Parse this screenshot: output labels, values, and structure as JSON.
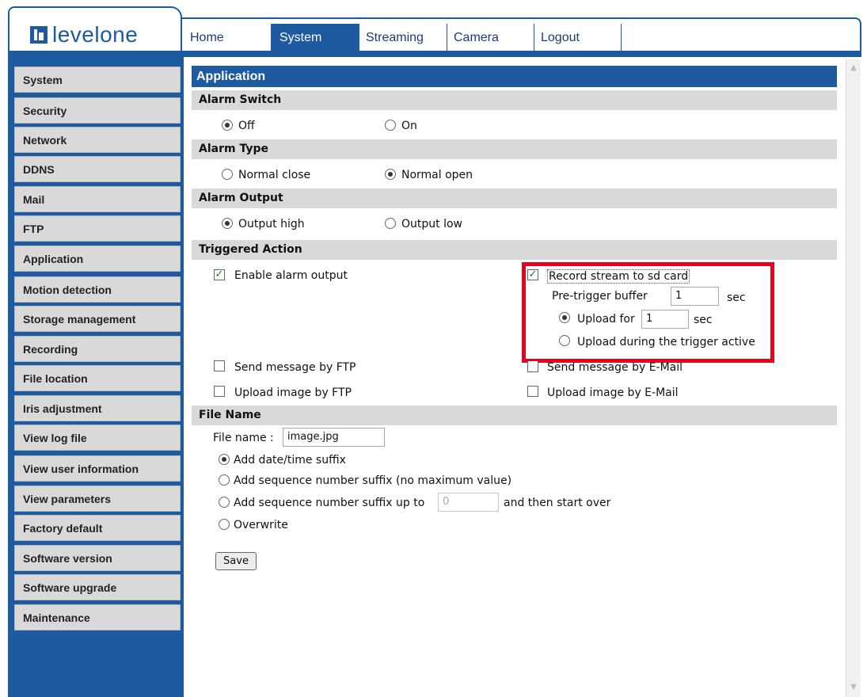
{
  "brand": {
    "name_part1": "level",
    "name_part2": "one"
  },
  "topnav": {
    "tabs": [
      {
        "label": "Home"
      },
      {
        "label": "System"
      },
      {
        "label": "Streaming"
      },
      {
        "label": "Camera"
      },
      {
        "label": "Logout"
      }
    ],
    "active": "System"
  },
  "sidebar": {
    "items": [
      {
        "label": "System"
      },
      {
        "label": "Security"
      },
      {
        "label": "Network"
      },
      {
        "label": "DDNS"
      },
      {
        "label": "Mail"
      },
      {
        "label": "FTP"
      },
      {
        "label": "Application"
      },
      {
        "label": "Motion detection"
      },
      {
        "label": "Storage management"
      },
      {
        "label": "Recording"
      },
      {
        "label": "File location"
      },
      {
        "label": "Iris adjustment"
      },
      {
        "label": "View log file"
      },
      {
        "label": "View user information"
      },
      {
        "label": "View parameters"
      },
      {
        "label": "Factory default"
      },
      {
        "label": "Software version"
      },
      {
        "label": "Software upgrade"
      },
      {
        "label": "Maintenance"
      }
    ]
  },
  "page": {
    "title": "Application"
  },
  "alarm_switch": {
    "title": "Alarm Switch",
    "off": "Off",
    "on": "On",
    "selected": "Off"
  },
  "alarm_type": {
    "title": "Alarm Type",
    "normal_close": "Normal close",
    "normal_open": "Normal open",
    "selected": "Normal open"
  },
  "alarm_output": {
    "title": "Alarm Output",
    "high": "Output high",
    "low": "Output low",
    "selected": "Output high"
  },
  "triggered_action": {
    "title": "Triggered Action",
    "enable_alarm_output": "Enable alarm output",
    "record_stream": "Record stream to sd card",
    "pre_trigger_label": "Pre-trigger buffer",
    "pre_trigger_value": "1",
    "sec": "sec",
    "upload_for_label": "Upload for",
    "upload_for_value": "1",
    "upload_during": "Upload during the trigger active",
    "send_ftp": "Send message by FTP",
    "send_email": "Send message by E-Mail",
    "upload_ftp": "Upload image by FTP",
    "upload_email": "Upload image by E-Mail",
    "checked": {
      "enable_alarm_output": true,
      "record_stream": true,
      "send_ftp": false,
      "send_email": false,
      "upload_ftp": false,
      "upload_email": false
    },
    "upload_mode_selected": "upload_for"
  },
  "file_name": {
    "title": "File Name",
    "label": "File name :",
    "value": "image.jpg",
    "opt_date": "Add date/time suffix",
    "opt_seq": "Add sequence number suffix (no maximum value)",
    "opt_seq_upto": "Add sequence number suffix up to",
    "seq_upto_value": "0",
    "opt_seq_after": "and then start over",
    "opt_overwrite": "Overwrite",
    "selected": "date"
  },
  "save_label": "Save",
  "colors": {
    "brand_blue": "#1e5aa0",
    "section_gray": "#d9d9d9",
    "highlight_red": "#e8001c"
  }
}
